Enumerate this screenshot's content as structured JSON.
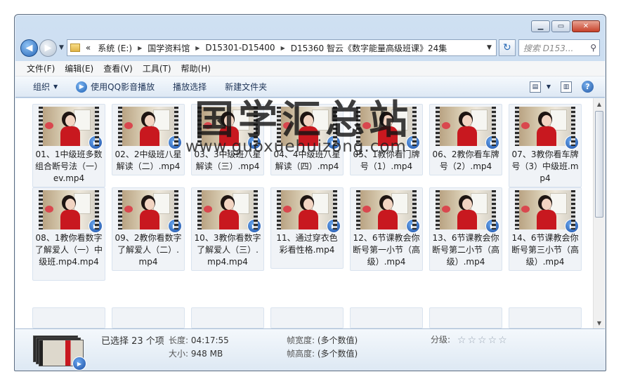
{
  "address": {
    "chevron": "«",
    "segments": [
      "系统 (E:)",
      "国学资料馆",
      "D15301-D15400",
      "D15360 智云《数字能量高级班课》24集"
    ]
  },
  "search": {
    "placeholder": "搜索 D153..."
  },
  "menu": [
    "文件(F)",
    "编辑(E)",
    "查看(V)",
    "工具(T)",
    "帮助(H)"
  ],
  "toolbar": {
    "organize": "组织",
    "play_qq": "使用QQ影音播放",
    "play_select": "播放选择",
    "new_folder": "新建文件夹"
  },
  "files": [
    "01、1中级班多数组合断号法（一）ev.mp4",
    "02、2中级班八星解读（二）.mp4",
    "03、3中级班八星解读（三）.mp4",
    "04、4中级班八星解读（四）.mp4",
    "05、1教你看门牌号（1）.mp4",
    "06、2教你看车牌号（2）.mp4",
    "07、3教你看车牌号（3）中级班.mp4",
    "08、1教你看数字了解爱人（一）中级班.mp4.mp4",
    "09、2教你看数字了解爱人（二）.mp4",
    "10、3教你看数字了解爱人（三）.mp4.mp4",
    "11、通过穿衣色彩看性格.mp4",
    "12、6节课教会你断号第一小节（高级）.mp4",
    "13、6节课教会你断号第二小节（高级）.mp4",
    "14、6节课教会你断号第三小节（高级）.mp4"
  ],
  "watermark": {
    "title": "国学汇总站",
    "url": "www.guoxuehuizong.com"
  },
  "details": {
    "selected": "已选择 23 个项",
    "length_label": "长度:",
    "length": "04:17:55",
    "size_label": "大小:",
    "size": "948 MB",
    "frame_width_label": "帧宽度:",
    "frame_width": "(多个数值)",
    "frame_height_label": "帧高度:",
    "frame_height": "(多个数值)",
    "rating_label": "分级:",
    "rating": 0
  }
}
